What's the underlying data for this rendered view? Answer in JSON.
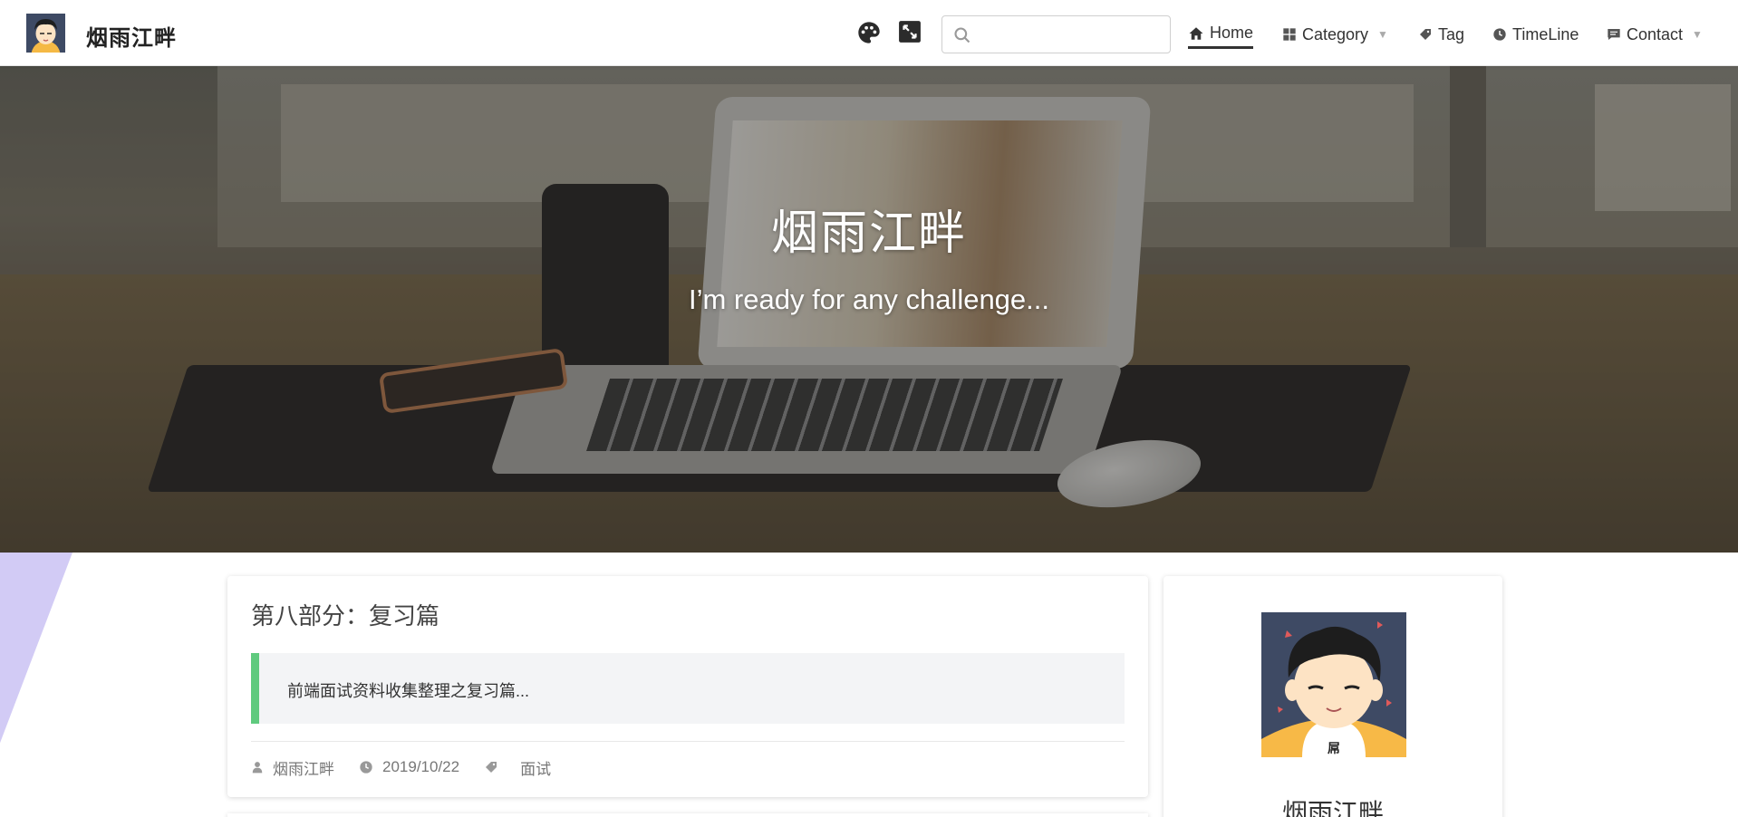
{
  "header": {
    "site_title": "烟雨江畔",
    "search": {
      "placeholder": "",
      "value": ""
    },
    "nav": [
      {
        "label": "Home",
        "icon": "home-icon",
        "active": true
      },
      {
        "label": "Category",
        "icon": "grid-icon",
        "has_dropdown": true
      },
      {
        "label": "Tag",
        "icon": "tag-icon"
      },
      {
        "label": "TimeLine",
        "icon": "clock-icon"
      },
      {
        "label": "Contact",
        "icon": "message-icon",
        "has_dropdown": true
      }
    ],
    "tools": [
      "palette-icon",
      "fullscreen-icon"
    ]
  },
  "hero": {
    "title": "烟雨江畔",
    "subtitle": "I’m ready for any challenge..."
  },
  "post": {
    "title": "第八部分：复习篇",
    "excerpt": "前端面试资料收集整理之复习篇...",
    "author": "烟雨江畔",
    "date": "2019/10/22",
    "tag": "面试"
  },
  "sidebar": {
    "name": "烟雨江畔"
  },
  "colors": {
    "accent_green": "#5fca7e",
    "deco_purple": "#d2cbf5",
    "text_dark": "#333333",
    "meta_gray": "#777777"
  }
}
